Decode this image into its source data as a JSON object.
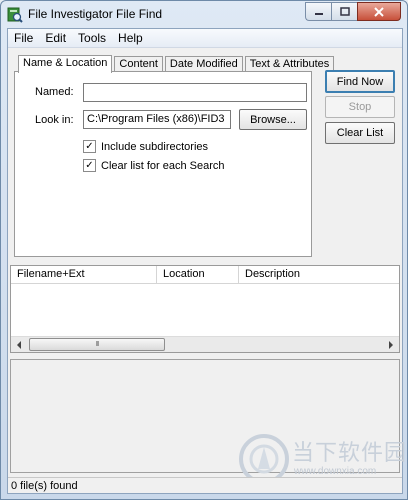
{
  "window": {
    "title": "File Investigator File Find"
  },
  "menu": [
    "File",
    "Edit",
    "Tools",
    "Help"
  ],
  "tabs": [
    "Name & Location",
    "Content",
    "Date Modified",
    "Text & Attributes"
  ],
  "form": {
    "named_label": "Named:",
    "named_value": "",
    "lookin_label": "Look in:",
    "lookin_value": "C:\\Program Files (x86)\\FID3",
    "browse_label": "Browse...",
    "include_subdirs_label": "Include subdirectories",
    "include_subdirs_checked": true,
    "clear_list_each_label": "Clear list for each Search",
    "clear_list_each_checked": true
  },
  "actions": {
    "find_now": "Find Now",
    "stop": "Stop",
    "clear_list": "Clear List"
  },
  "results": {
    "columns": [
      "Filename+Ext",
      "Location",
      "Description"
    ],
    "rows": []
  },
  "scrollbar": {
    "thumb_grip": "III"
  },
  "watermark": {
    "text": "当下软件园",
    "url": "www.downxia.com"
  },
  "status": {
    "text": "0 file(s) found"
  },
  "colors": {
    "title_gradient_top": "#dfe9f5",
    "close_button": "#c7503a",
    "default_button_border": "#3c7fb1"
  }
}
